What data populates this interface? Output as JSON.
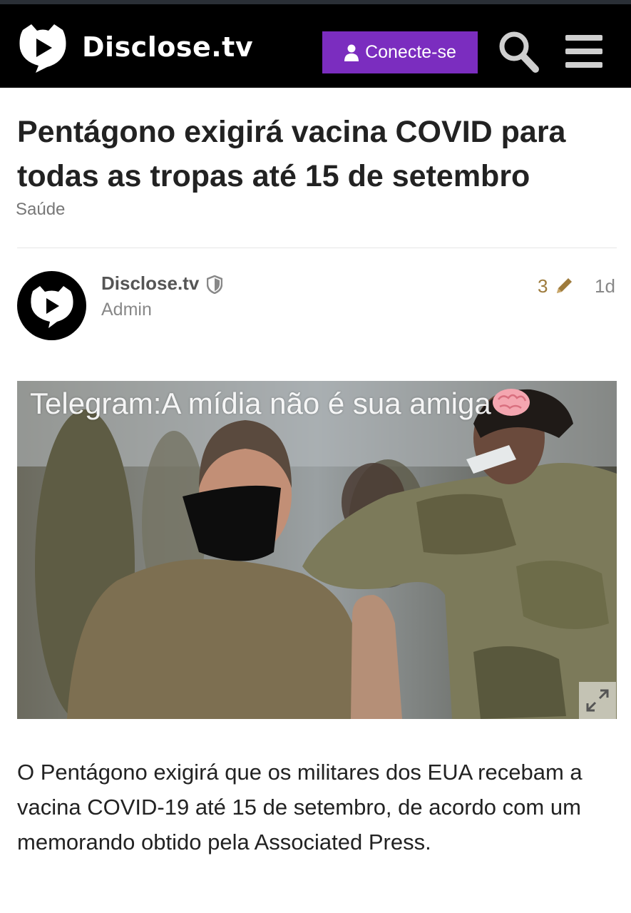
{
  "site": {
    "name": "Disclose.tv",
    "logo_icon": "play-cat-logo-icon"
  },
  "header": {
    "login_label": "Conecte-se",
    "search_icon": "search-icon",
    "menu_icon": "hamburger-menu-icon"
  },
  "article": {
    "title": "Pentágono exigirá vacina COVID para todas as tropas até 15 de setembro",
    "category": "Saúde",
    "body": "O Pentágono exigirá que os militares dos EUA recebam a vacina COVID-19 até 15 de setembro, de acordo com um memorando obtido pela Associated Press."
  },
  "post": {
    "author": "Disclose.tv",
    "role": "Admin",
    "edit_count": "3",
    "age": "1d"
  },
  "image": {
    "watermark": "Telegram:A mídia não é sua amiga",
    "brain_icon": "brain-icon",
    "expand_icon": "expand-icon"
  },
  "colors": {
    "header_bg": "#000000",
    "login_button": "#7b2dbf",
    "edit_accent": "#9e7b3c"
  }
}
